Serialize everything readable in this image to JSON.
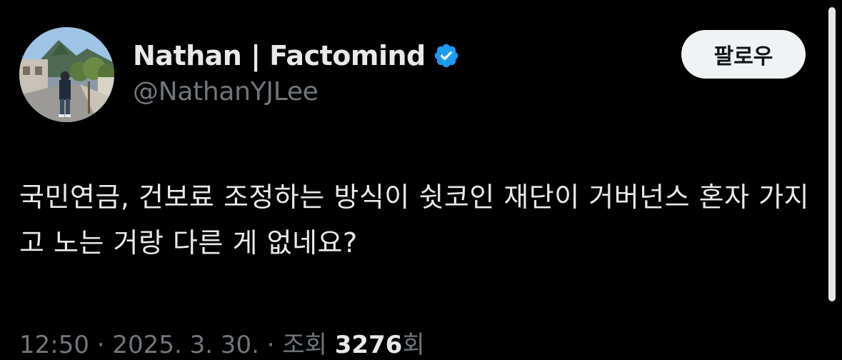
{
  "author": {
    "display_name": "Nathan | Factomind",
    "handle": "@NathanYJLee",
    "verified": true,
    "verified_icon": "verified-badge-icon",
    "verified_color": "#1d9bf0"
  },
  "actions": {
    "follow_label": "팔로우"
  },
  "tweet": {
    "text": "국민연금, 건보료 조정하는 방식이 쉿코인 재단이 거버넌스 혼자 가지고 노는 거랑 다른 게 없네요?"
  },
  "meta": {
    "time": "12:50",
    "date": "2025. 3. 30.",
    "views_label": "조회",
    "views_count": "3276",
    "views_suffix": "회"
  },
  "colors": {
    "background": "#000000",
    "primary_text": "#e7e9ea",
    "secondary_text": "#71767b",
    "button_bg": "#eff3f4"
  }
}
